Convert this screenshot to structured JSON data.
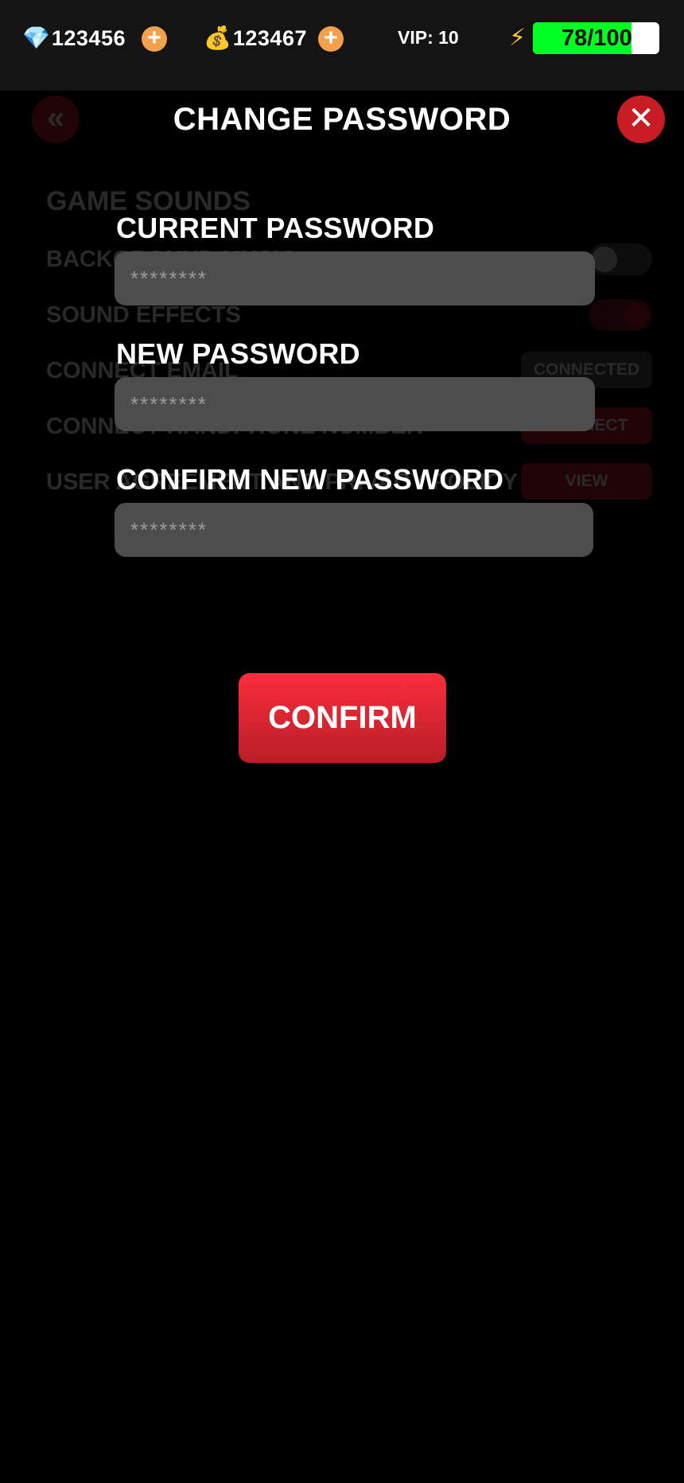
{
  "topbar": {
    "gems": {
      "icon": "gem-icon",
      "glyph": "💎",
      "value": "123456"
    },
    "coins": {
      "icon": "money-bag-icon",
      "glyph": "💰",
      "value": "123467"
    },
    "plus_glyph": "+",
    "vip": "VIP: 10",
    "energy": {
      "icon": "lightning-icon",
      "glyph": "⚡",
      "label": "78/100",
      "current": 78,
      "max": 100
    }
  },
  "background_settings": {
    "back_glyph": "«",
    "heading": "GAME SOUNDS",
    "rows": [
      {
        "label": "BACKGROUND MUSIC"
      },
      {
        "label": "SOUND EFFECTS"
      },
      {
        "label": "CONNECT EMAIL",
        "action": "CONNECTED"
      },
      {
        "label": "CONNECT HANDPHONE NUMBER",
        "action": "CONNECT"
      },
      {
        "label": "USER AGREEMENT AND PRIVACY POLICY",
        "action": "VIEW"
      }
    ]
  },
  "modal": {
    "title": "CHANGE PASSWORD",
    "close_glyph": "✕",
    "fields": [
      {
        "label": "CURRENT PASSWORD",
        "placeholder": "********"
      },
      {
        "label": "NEW PASSWORD",
        "placeholder": "********"
      },
      {
        "label": "CONFIRM NEW PASSWORD",
        "placeholder": "********"
      }
    ],
    "confirm_label": "CONFIRM"
  },
  "colors": {
    "accent_red": "#c81d25",
    "plus_orange": "#f3a04c",
    "energy_green": "#00ff23",
    "input_bg": "#4d4d4d"
  }
}
